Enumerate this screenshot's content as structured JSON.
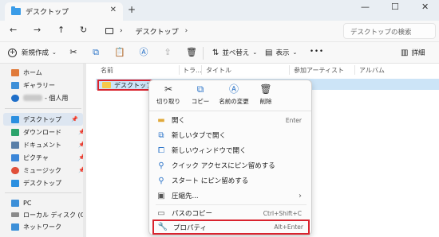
{
  "window": {
    "tab_title": "デスクトップ",
    "tab_close": "✕",
    "new_tab": "+",
    "minimize": "—",
    "maximize": "☐",
    "close": "✕"
  },
  "nav": {
    "back": "←",
    "forward": "→",
    "up": "↑",
    "refresh": "↻",
    "chevron": "›",
    "path_item": "デスクトップ",
    "path_chevron": "›",
    "search_placeholder": "デスクトップの検索"
  },
  "toolbar": {
    "new_label": "新規作成",
    "sort_label": "並べ替え",
    "view_label": "表示",
    "more": "•••",
    "details_label": "詳細"
  },
  "sidebar": {
    "items": [
      {
        "label": "ホーム"
      },
      {
        "label": "ギャラリー"
      },
      {
        "label": "- 個人用"
      },
      {
        "label": "デスクトップ"
      },
      {
        "label": "ダウンロード"
      },
      {
        "label": "ドキュメント"
      },
      {
        "label": "ピクチャ"
      },
      {
        "label": "ミュージック"
      },
      {
        "label": "デスクトップ"
      },
      {
        "label": "PC"
      },
      {
        "label": "ローカル ディスク (C:)"
      },
      {
        "label": "ネットワーク"
      }
    ]
  },
  "columns": {
    "name": "名前",
    "track": "トラ...",
    "title": "タイトル",
    "artist": "参加アーティスト",
    "album": "アルバム"
  },
  "files": [
    {
      "name": "デスクトップ"
    }
  ],
  "context_menu": {
    "quick": [
      {
        "label": "切り取り",
        "icon": "✂"
      },
      {
        "label": "コピー",
        "icon": "⧉"
      },
      {
        "label": "名前の変更",
        "icon": "Ⓐ"
      },
      {
        "label": "削除",
        "icon": "🗑"
      }
    ],
    "items": [
      {
        "label": "開く",
        "shortcut": "Enter"
      },
      {
        "label": "新しいタブで開く",
        "shortcut": ""
      },
      {
        "label": "新しいウィンドウで開く",
        "shortcut": ""
      },
      {
        "label": "クイック アクセスにピン留めする",
        "shortcut": ""
      },
      {
        "label": "スタート にピン留めする",
        "shortcut": ""
      },
      {
        "label": "圧縮先...",
        "shortcut": "›"
      },
      {
        "label": "パスのコピー",
        "shortcut": "Ctrl+Shift+C"
      },
      {
        "label": "プロパティ",
        "shortcut": "Alt+Enter"
      }
    ]
  },
  "colors": {
    "highlight": "#d9232e",
    "selection": "#cce4f7",
    "accent": "#2a73c8"
  }
}
